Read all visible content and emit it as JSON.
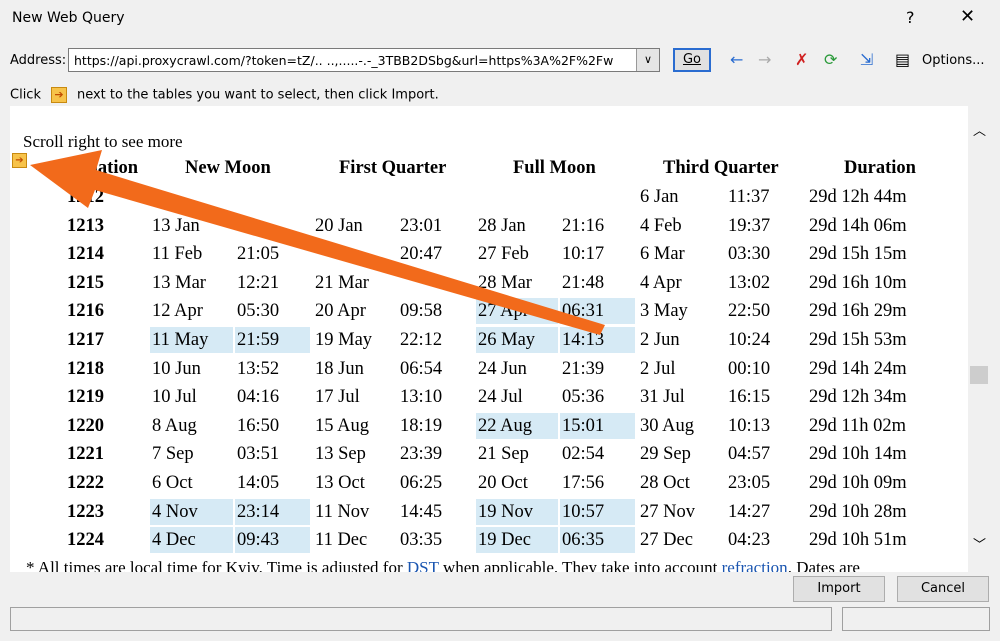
{
  "window": {
    "title": "New Web Query",
    "help": "?",
    "close": "✕"
  },
  "address": {
    "label": "Address:",
    "value": "https://api.proxycrawl.com/?token=tZ/.. ..,.....-.-_3TBB2DSbg&url=https%3A%2F%2Fw",
    "go": "Go"
  },
  "toolbar": {
    "back": "←",
    "forward": "→",
    "stop": "✗",
    "refresh": "⟳",
    "hide_icons": "⇲",
    "options": "Options..."
  },
  "instruction": {
    "pre": "Click",
    "icon": "➔",
    "post": "next to the tables you want to select, then click Import."
  },
  "page": {
    "scroll_hint": "Scroll right to see more",
    "table_select_icon": "➔",
    "headers": [
      "Lunation",
      "New Moon",
      "First Quarter",
      "Full Moon",
      "Third Quarter",
      "Duration"
    ],
    "rows": [
      {
        "cells": [
          "1212",
          "",
          "",
          "",
          "",
          "",
          "",
          "6 Jan",
          "11:37",
          "29d 12h 44m"
        ],
        "hl": []
      },
      {
        "cells": [
          "1213",
          "13 Jan",
          "",
          "20 Jan",
          "23:01",
          "28 Jan",
          "21:16",
          "4 Feb",
          "19:37",
          "29d 14h 06m"
        ],
        "hl": []
      },
      {
        "cells": [
          "1214",
          "11 Feb",
          "21:05",
          "",
          "20:47",
          "27 Feb",
          "10:17",
          "6 Mar",
          "03:30",
          "29d 15h 15m"
        ],
        "hl": []
      },
      {
        "cells": [
          "1215",
          "13 Mar",
          "12:21",
          "21 Mar",
          "",
          "28 Mar",
          "21:48",
          "4 Apr",
          "13:02",
          "29d 16h 10m"
        ],
        "hl": []
      },
      {
        "cells": [
          "1216",
          "12 Apr",
          "05:30",
          "20 Apr",
          "09:58",
          "27 Apr",
          "06:31",
          "3 May",
          "22:50",
          "29d 16h 29m"
        ],
        "hl": [
          5,
          6
        ]
      },
      {
        "cells": [
          "1217",
          "11 May",
          "21:59",
          "19 May",
          "22:12",
          "26 May",
          "14:13",
          "2 Jun",
          "10:24",
          "29d 15h 53m"
        ],
        "hl": [
          1,
          2,
          5,
          6
        ]
      },
      {
        "cells": [
          "1218",
          "10 Jun",
          "13:52",
          "18 Jun",
          "06:54",
          "24 Jun",
          "21:39",
          "2 Jul",
          "00:10",
          "29d 14h 24m"
        ],
        "hl": []
      },
      {
        "cells": [
          "1219",
          "10 Jul",
          "04:16",
          "17 Jul",
          "13:10",
          "24 Jul",
          "05:36",
          "31 Jul",
          "16:15",
          "29d 12h 34m"
        ],
        "hl": []
      },
      {
        "cells": [
          "1220",
          "8 Aug",
          "16:50",
          "15 Aug",
          "18:19",
          "22 Aug",
          "15:01",
          "30 Aug",
          "10:13",
          "29d 11h 02m"
        ],
        "hl": [
          5,
          6
        ]
      },
      {
        "cells": [
          "1221",
          "7 Sep",
          "03:51",
          "13 Sep",
          "23:39",
          "21 Sep",
          "02:54",
          "29 Sep",
          "04:57",
          "29d 10h 14m"
        ],
        "hl": []
      },
      {
        "cells": [
          "1222",
          "6 Oct",
          "14:05",
          "13 Oct",
          "06:25",
          "20 Oct",
          "17:56",
          "28 Oct",
          "23:05",
          "29d 10h 09m"
        ],
        "hl": []
      },
      {
        "cells": [
          "1223",
          "4 Nov",
          "23:14",
          "11 Nov",
          "14:45",
          "19 Nov",
          "10:57",
          "27 Nov",
          "14:27",
          "29d 10h 28m"
        ],
        "hl": [
          1,
          2,
          5,
          6
        ]
      },
      {
        "cells": [
          "1224",
          "4 Dec",
          "09:43",
          "11 Dec",
          "03:35",
          "19 Dec",
          "06:35",
          "27 Dec",
          "04:23",
          "29d 10h 51m"
        ],
        "hl": [
          1,
          2,
          5,
          6
        ]
      }
    ],
    "footnote": {
      "t1": "* All times are local time for Kyiv. Time is adjusted for ",
      "link1": "DST",
      "t2": " when applicable. They take into account ",
      "link2": "refraction",
      "t3": ". Dates are"
    }
  },
  "buttons": {
    "import": "Import",
    "cancel": "Cancel"
  },
  "colors": {
    "highlight": "#d6eaf5",
    "arrow": "#f26a1b",
    "icon": "#f7c34a",
    "link": "#1a55b0"
  }
}
